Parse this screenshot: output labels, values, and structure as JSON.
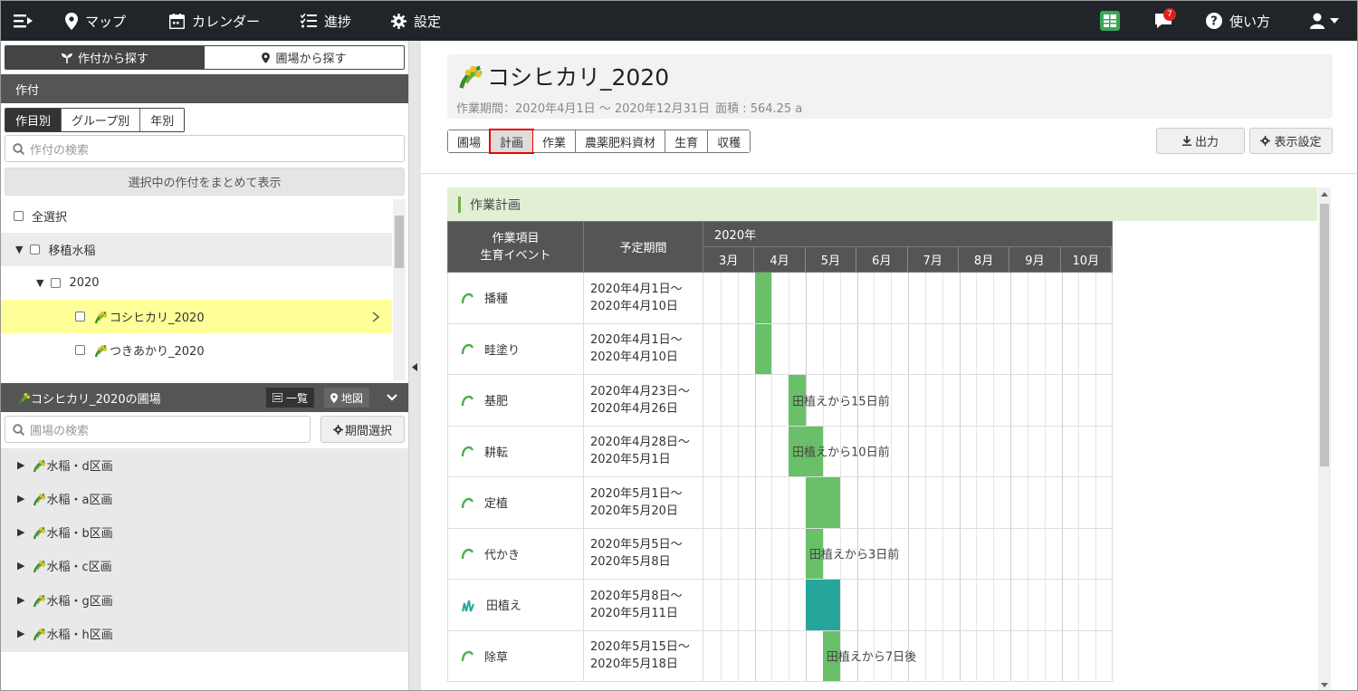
{
  "nav": {
    "map": "マップ",
    "calendar": "カレンダー",
    "progress": "進捗",
    "settings": "設定",
    "badge": "7",
    "help": "使い方"
  },
  "left": {
    "search_by_crop": "作付から探す",
    "search_by_field": "圃場から探す",
    "section_crop": "作付",
    "subtabs": [
      "作目別",
      "グループ別",
      "年別"
    ],
    "crop_search_placeholder": "作付の検索",
    "show_selected": "選択中の作付をまとめて表示",
    "tree": {
      "select_all": "全選択",
      "group": "移植水稲",
      "year": "2020",
      "items": [
        "コシヒカリ_2020",
        "つきあかり_2020"
      ]
    },
    "fields_header": "コシヒカリ_2020の圃場",
    "view_list": "一覧",
    "view_map": "地図",
    "field_search_placeholder": "圃場の検索",
    "period_select": "期間選択",
    "fields": [
      "水稲・d区画",
      "水稲・a区画",
      "水稲・b区画",
      "水稲・c区画",
      "水稲・g区画",
      "水稲・h区画"
    ]
  },
  "main": {
    "title": "コシヒカリ_2020",
    "period_text": "作業期間：2020年4月1日 〜 2020年12月31日",
    "area_text": "面積 : 564.25 a",
    "tabs": [
      "圃場",
      "計画",
      "作業",
      "農薬肥料資材",
      "生育",
      "収穫"
    ],
    "export": "出力",
    "display_settings": "表示設定",
    "section_title": "作業計画",
    "col_item": "作業項目",
    "col_item2": "生育イベント",
    "col_period": "予定期間",
    "year": "2020年",
    "months": [
      "3月",
      "4月",
      "5月",
      "6月",
      "7月",
      "8月",
      "9月",
      "10月"
    ],
    "rows": [
      {
        "name": "播種",
        "p1": "2020年4月1日〜",
        "p2": "2020年4月10日",
        "label": ""
      },
      {
        "name": "畦塗り",
        "p1": "2020年4月1日〜",
        "p2": "2020年4月10日",
        "label": ""
      },
      {
        "name": "基肥",
        "p1": "2020年4月23日〜",
        "p2": "2020年4月26日",
        "label": "田植えから15日前"
      },
      {
        "name": "耕転",
        "p1": "2020年4月28日〜",
        "p2": "2020年5月1日",
        "label": "田植えから10日前"
      },
      {
        "name": "定植",
        "p1": "2020年5月1日〜",
        "p2": "2020年5月20日",
        "label": ""
      },
      {
        "name": "代かき",
        "p1": "2020年5月5日〜",
        "p2": "2020年5月8日",
        "label": "田植えから3日前"
      },
      {
        "name": "田植え",
        "p1": "2020年5月8日〜",
        "p2": "2020年5月11日",
        "label": ""
      },
      {
        "name": "除草",
        "p1": "2020年5月15日〜",
        "p2": "2020年5月18日",
        "label": "田植えから7日後"
      }
    ]
  }
}
